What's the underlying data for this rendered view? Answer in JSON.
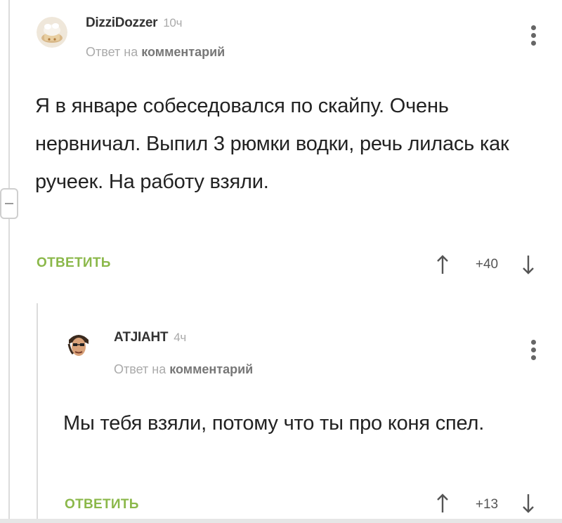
{
  "comments": [
    {
      "username": "DizziDozzer",
      "time_ago": "10ч",
      "reply_prefix": "Ответ на",
      "reply_target": "комментарий",
      "text": "Я в январе собеседовался по скайпу. Очень нервничал. Выпил 3 рюмки водки, речь лилась как ручеек. На работу взяли.",
      "reply_label": "ОТВЕТИТЬ",
      "score": "+40",
      "avatar_icon": "hat-avatar-icon"
    },
    {
      "username": "АТJIАНТ",
      "time_ago": "4ч",
      "reply_prefix": "Ответ на",
      "reply_target": "комментарий",
      "text": "Мы тебя взяли, потому что ты про коня спел.",
      "reply_label": "ОТВЕТИТЬ",
      "score": "+13",
      "avatar_icon": "person-avatar-icon"
    }
  ],
  "colors": {
    "accent_green": "#8bb84a",
    "muted_gray": "#aaaaaa",
    "text": "#222222"
  }
}
